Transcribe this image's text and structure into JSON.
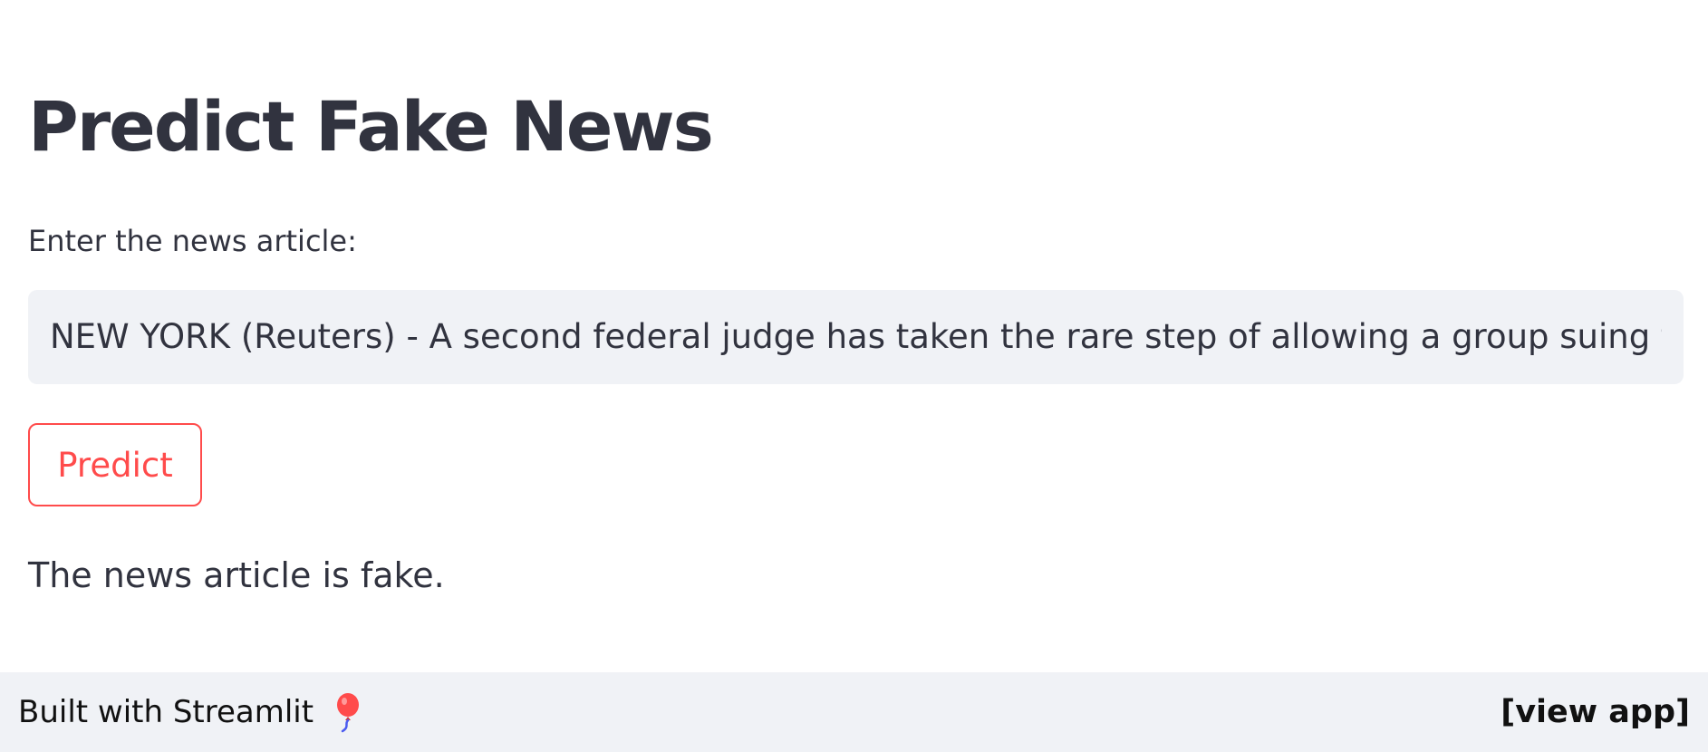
{
  "main": {
    "title": "Predict Fake News",
    "input_label": "Enter the news article:",
    "input_value": "NEW YORK (Reuters) - A second federal judge has taken the rare step of allowing a group suing for records",
    "predict_button_label": "Predict",
    "result_text": "The news article is fake."
  },
  "footer": {
    "built_with": "Built with Streamlit",
    "balloon_icon": "balloon-icon",
    "view_app_label": "[view app]"
  },
  "colors": {
    "accent": "#ff4b4b",
    "text": "#31333f",
    "input_bg": "#f0f2f6",
    "footer_bg": "#f0f2f6"
  }
}
